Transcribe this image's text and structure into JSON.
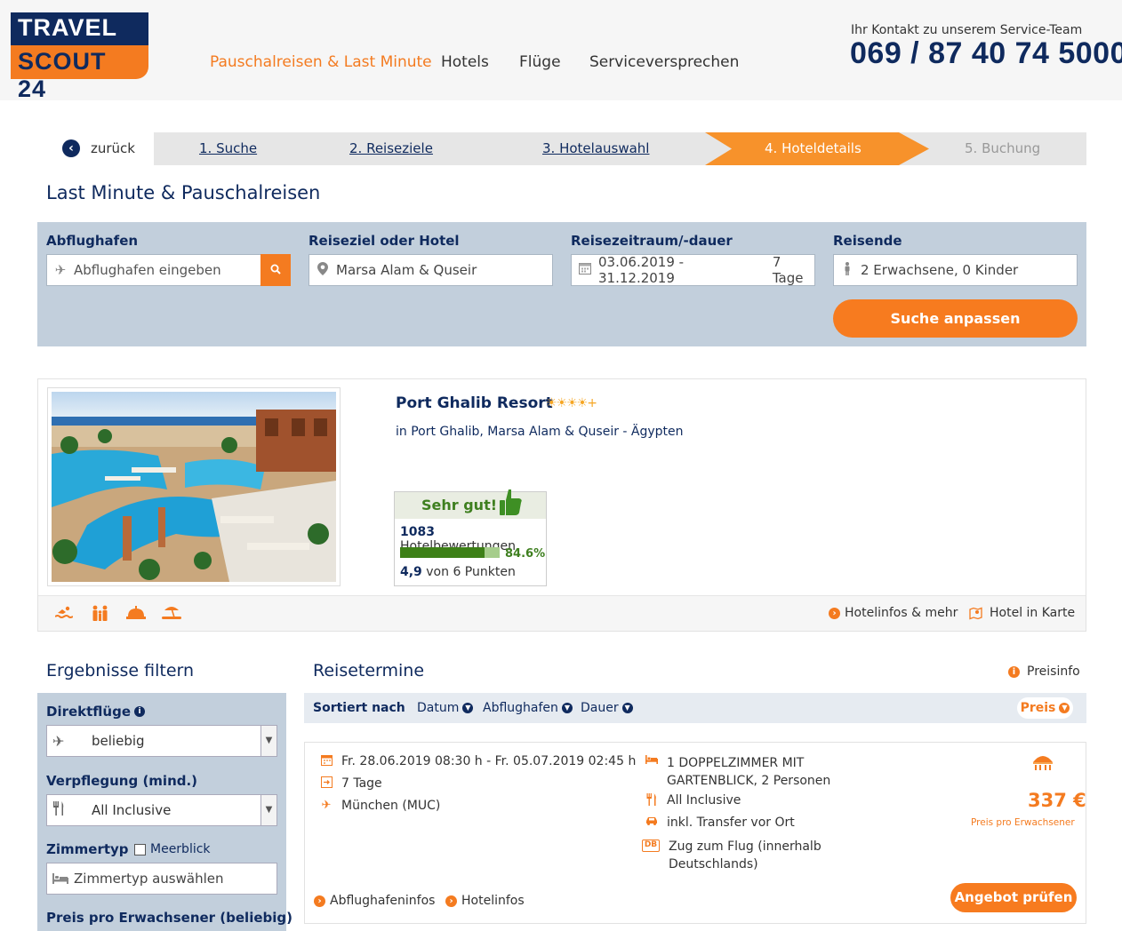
{
  "header": {
    "logo_top": "TRAVEL",
    "logo_bottom": "SCOUT 24",
    "nav": [
      "Pauschalreisen & Last Minute",
      "Hotels",
      "Flüge",
      "Serviceversprechen"
    ],
    "contact_label": "Ihr Kontakt zu unserem Service-Team",
    "contact_phone": "069 / 87 40 74 5000"
  },
  "steps": {
    "back_label": "zurück",
    "items": [
      "1. Suche",
      "2. Reiseziele",
      "3. Hotelauswahl",
      "4. Hoteldetails",
      "5. Buchung"
    ],
    "active_index": 3
  },
  "page_title": "Last Minute & Pauschalreisen",
  "search": {
    "departure_label": "Abflughafen",
    "departure_placeholder": "Abflughafen eingeben",
    "destination_label": "Reiseziel oder Hotel",
    "destination_value": "Marsa Alam & Quseir",
    "period_label": "Reisezeitraum/-dauer",
    "period_value": "03.06.2019 - 31.12.2019",
    "duration_value": "7 Tage",
    "travellers_label": "Reisende",
    "travellers_value": "2 Erwachsene, 0 Kinder",
    "submit_label": "Suche anpassen"
  },
  "hotel": {
    "name": "Port Ghalib Resort",
    "stars": "☀☀☀☀+",
    "location": "in Port Ghalib, Marsa Alam & Quseir - Ägypten",
    "rating_title": "Sehr gut!",
    "reviews_count": "1083",
    "reviews_label": "Hotelbewertungen",
    "recommend_percent": 84.6,
    "recommend_label": "84.6%",
    "score": "4,9",
    "score_label": "von 6 Punkten",
    "amenities": [
      "swimming-icon",
      "family-icon",
      "service-bell-icon",
      "beach-icon"
    ],
    "info_link": "Hotelinfos & mehr",
    "map_link": "Hotel in Karte"
  },
  "filter": {
    "title": "Ergebnisse filtern",
    "direct_label": "Direktflüge",
    "direct_value": "beliebig",
    "board_label": "Verpflegung (mind.)",
    "board_value": "All Inclusive",
    "room_label": "Zimmertyp",
    "seaview_label": "Meerblick",
    "room_placeholder": "Zimmertyp auswählen",
    "price_label": "Preis pro Erwachsener (beliebig)"
  },
  "results": {
    "title": "Reisetermine",
    "preisinfo": "Preisinfo",
    "sort_label": "Sortiert nach",
    "sort_options": [
      "Datum",
      "Abflughafen",
      "Dauer"
    ],
    "sort_active": "Preis",
    "offer": {
      "dates": "Fr. 28.06.2019 08:30 h - Fr. 05.07.2019 02:45 h",
      "duration": "7 Tage",
      "airport": "München (MUC)",
      "room_line1": "1 DOPPELZIMMER MIT",
      "room_line2": "GARTENBLICK, 2 Personen",
      "board": "All Inclusive",
      "transfer": "inkl. Transfer vor Ort",
      "train_badge": "DB",
      "train_line1": "Zug zum Flug (innerhalb",
      "train_line2": "Deutschlands)",
      "price": "337 €",
      "price_sub": "Preis pro Erwachsener",
      "airport_info": "Abflughafeninfos",
      "hotel_info": "Hotelinfos",
      "cta": "Angebot prüfen"
    }
  },
  "colors": {
    "brand_blue": "#0f2a5e",
    "brand_orange": "#f47b20",
    "rating_green": "#3d8017"
  }
}
